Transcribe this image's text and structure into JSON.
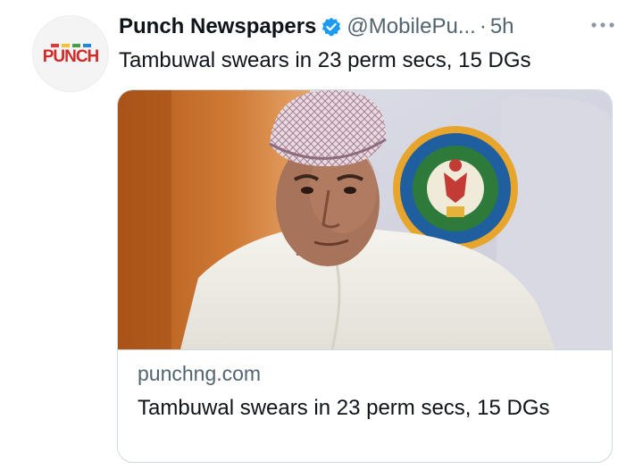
{
  "account": {
    "display_name": "Punch Newspapers",
    "handle": "@MobilePu...",
    "separator": "·",
    "time": "5h",
    "avatar_text": "PUNCH",
    "verified_color": "#1d9bf0"
  },
  "tweet": {
    "text": "Tambuwal swears in 23 perm secs, 15 DGs"
  },
  "card": {
    "domain": "punchng.com",
    "title": "Tambuwal swears in 23 perm secs, 15 DGs"
  },
  "icons": {
    "verified": "verified-badge-icon",
    "more": "more-options-icon"
  },
  "colors": {
    "text_primary": "#0f1419",
    "text_secondary": "#536471",
    "border": "#cfd9de",
    "logo_red": "#d22a2a"
  }
}
